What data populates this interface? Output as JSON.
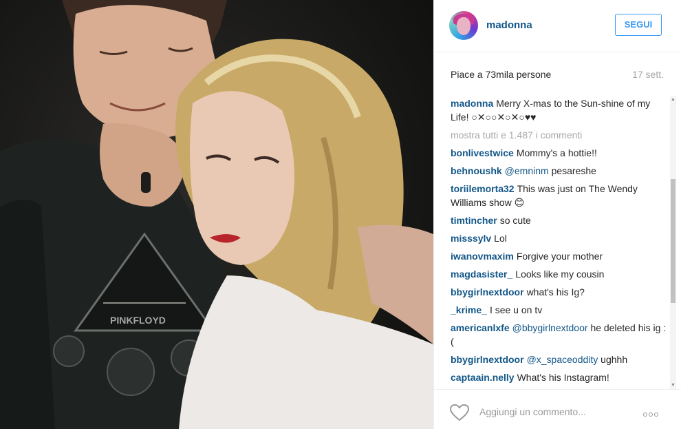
{
  "post": {
    "username": "madonna",
    "follow_label": "SEGUI",
    "likes": "Piace a 73mila persone",
    "time": "17 sett.",
    "caption": {
      "user": "madonna",
      "text": "Merry X-mas to the Sun-shine of my Life! ○✕○○✕○✕○♥♥"
    },
    "show_all": "mostra tutti e 1.487 i commenti",
    "comments": [
      {
        "user": "bonlivestwice",
        "mention": "",
        "text": "Mommy's a hottie!!"
      },
      {
        "user": "behnoushk",
        "mention": "@emninm",
        "text": "pesareshe"
      },
      {
        "user": "toriilemorta32",
        "mention": "",
        "text": "This was just on The Wendy Williams show 😊"
      },
      {
        "user": "timtincher",
        "mention": "",
        "text": "so cute"
      },
      {
        "user": "misssylv",
        "mention": "",
        "text": "Lol"
      },
      {
        "user": "iwanovmaxim",
        "mention": "",
        "text": "Forgive your mother"
      },
      {
        "user": "magdasister_",
        "mention": "",
        "text": "Looks like my cousin"
      },
      {
        "user": "bbygirlnextdoor",
        "mention": "",
        "text": "what's his Ig?"
      },
      {
        "user": "_krime_",
        "mention": "",
        "text": "I see u on tv"
      },
      {
        "user": "americanlxfe",
        "mention": "@bbygirlnextdoor",
        "text": "he deleted his ig :("
      },
      {
        "user": "bbygirlnextdoor",
        "mention": "@x_spaceoddity",
        "text": "ughhh"
      },
      {
        "user": "captaain.nelly",
        "mention": "",
        "text": "What's his Instagram!"
      }
    ],
    "comment_placeholder": "Aggiungi un commento...",
    "photo_print": "PINKFLOYD"
  },
  "colors": {
    "username": "#125688",
    "follow": "#3897f0",
    "muted": "#a5a7aa"
  },
  "icons": {
    "like": "heart-outline-icon",
    "more": "more-options-icon"
  }
}
